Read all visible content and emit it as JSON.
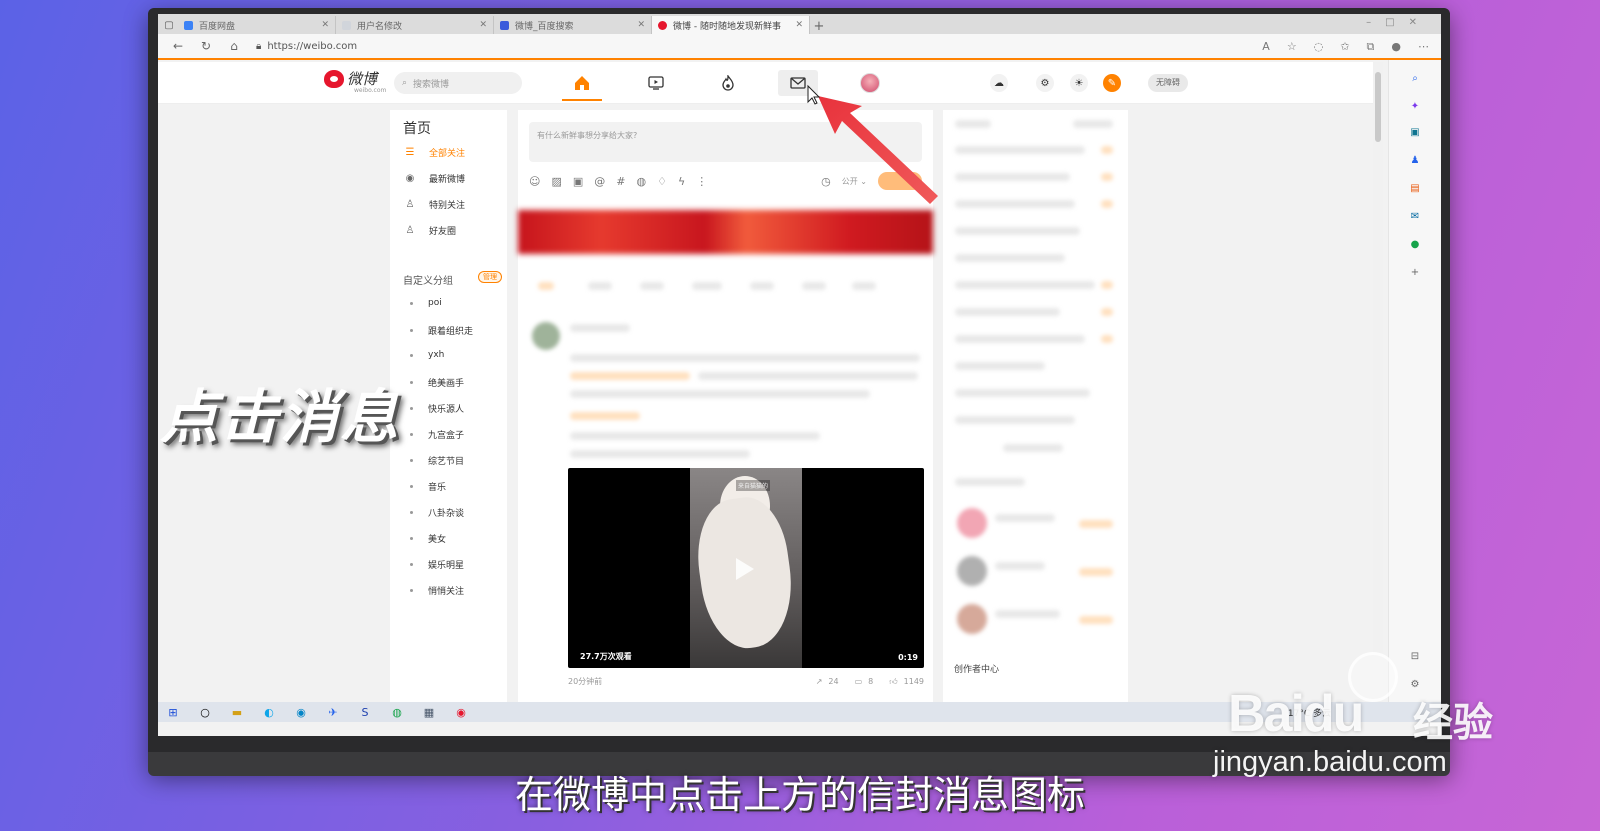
{
  "browser": {
    "tabs": [
      {
        "label": "百度网盘",
        "active": false,
        "color": "#3b82f6"
      },
      {
        "label": "用户名修改",
        "active": false,
        "color": "#9ca3af"
      },
      {
        "label": "微博_百度搜索",
        "active": false,
        "color": "#3b5bdb"
      },
      {
        "label": "微博 - 随时随地发现新鲜事",
        "active": true,
        "color": "#e6162d"
      }
    ],
    "url": "https://weibo.com"
  },
  "weibo": {
    "logo_text": "微博",
    "logo_sub": "weibo.com",
    "search_placeholder": "搜索微博",
    "accessibility_button": "无障碍",
    "left_nav": {
      "title": "首页",
      "items": [
        "全部关注",
        "最新微博",
        "特别关注",
        "好友圈"
      ],
      "group_title": "自定义分组",
      "group_badge": "管理",
      "groups": [
        "poi",
        "跟着组织走",
        "yxh",
        "绝美画手",
        "快乐源人",
        "九宫盒子",
        "综艺节目",
        "音乐",
        "八卦杂谈",
        "美女",
        "娱乐明星",
        "悄悄关注"
      ]
    },
    "compose_placeholder": "有什么新鲜事想分享给大家?",
    "visibility": "公开",
    "post": {
      "video_views": "27.7万次观看",
      "video_duration": "0:19",
      "video_caption": "来自猫猫的",
      "time": "20分钟前",
      "shares": "24",
      "comments": "8",
      "likes": "1149"
    },
    "right_panel": {
      "creator_center": "创作者中心"
    }
  },
  "taskbar": {
    "weather": "17°C 多云"
  },
  "overlay": {
    "title": "点击消息",
    "subtitle": "在微博中点击上方的信封消息图标"
  },
  "watermark": {
    "logo": "Baidu",
    "cn": "经验",
    "url": "jingyan.baidu.com"
  },
  "colors": {
    "weibo_orange": "#ff8200",
    "arrow_red": "#e8323c"
  }
}
